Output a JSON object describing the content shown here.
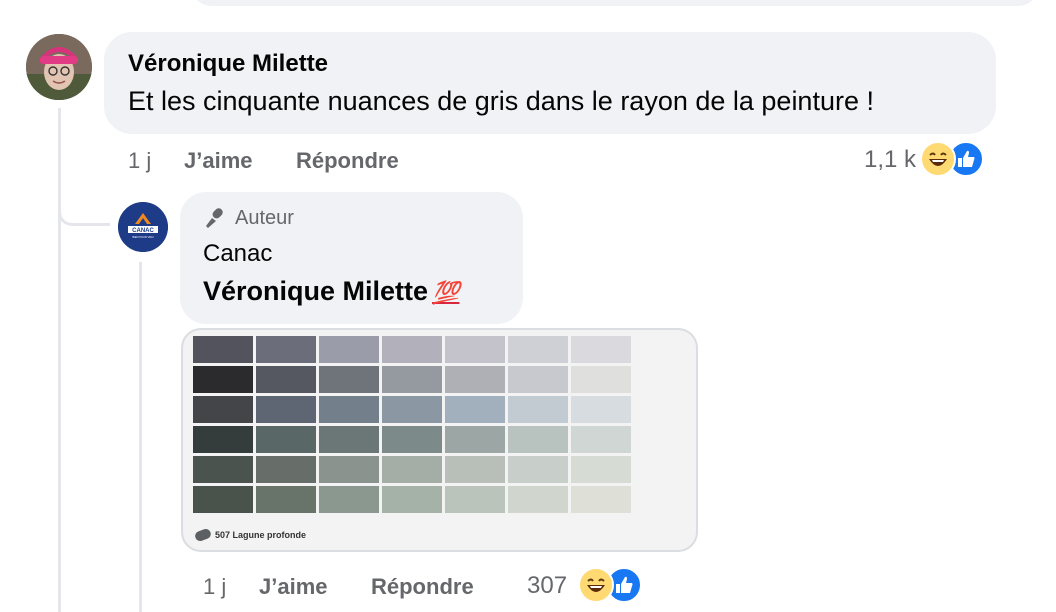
{
  "comment": {
    "author": "Véronique Milette",
    "text": "Et les cinquante nuances de gris dans le rayon de la peinture !",
    "time": "1 j",
    "like_label": "J’aime",
    "reply_label": "Répondre",
    "reaction_count": "1,1 k",
    "reactions": [
      "haha-reaction-icon",
      "like-reaction-icon"
    ]
  },
  "reply": {
    "badge_label": "Auteur",
    "author": "Canac",
    "text": "Véronique Milette",
    "emoji": "💯",
    "image_caption": "507 Lagune profonde",
    "time": "1 j",
    "like_label": "J’aime",
    "reply_label": "Répondre",
    "reaction_count": "307",
    "reactions": [
      "haha-reaction-icon",
      "like-reaction-icon"
    ]
  },
  "logo": {
    "text": "CANAC",
    "tagline": "BIEN POUR VRAI"
  },
  "palette": [
    [
      "#52535d",
      "#6c6d7a",
      "#9a9ca9",
      "#b1b0bb",
      "#c4c3cc",
      "#cfcfd6",
      "#dad9de"
    ],
    [
      "#2b2b2d",
      "#555860",
      "#6f737a",
      "#959aa1",
      "#aeb0b6",
      "#c7c9ce",
      "#dfe0dd"
    ],
    [
      "#444549",
      "#5d6672",
      "#73808b",
      "#8b97a2",
      "#a1b0bc",
      "#c1cbd1",
      "#d6dcdf"
    ],
    [
      "#353c3c",
      "#596766",
      "#6b7776",
      "#7c8a8a",
      "#9ba6a5",
      "#b8c2bf",
      "#cfd6d3"
    ],
    [
      "#4b534f",
      "#676d69",
      "#8a938d",
      "#a4ada6",
      "#b7bfb8",
      "#c8cec9",
      "#d6dbd4"
    ],
    [
      "#49524b",
      "#687469",
      "#8b9890",
      "#a4b2a8",
      "#bac4bb",
      "#d0d6ce",
      "#dedfd6"
    ]
  ]
}
